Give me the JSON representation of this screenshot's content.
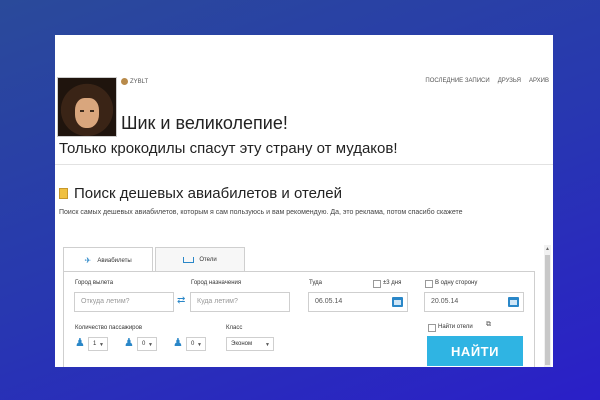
{
  "header": {
    "username": "ZYBLT",
    "nav": [
      "ПОСЛЕДНИЕ ЗАПИСИ",
      "ДРУЗЬЯ",
      "АРХИВ"
    ],
    "title": "Шик и великолепие!",
    "subtitle": "Только крокодилы спасут эту страну от мудаков!"
  },
  "section": {
    "title": "Поиск дешевых авиабилетов и отелей",
    "desc": "Поиск самых дешевых авиабилетов, которым я сам пользуюсь и вам рекомендую. Да, это реклама, потом спасибо скажете"
  },
  "widget": {
    "tabs": [
      "Авиабилеты",
      "Отели"
    ],
    "from_label": "Город вылета",
    "from_placeholder": "Откуда летим?",
    "to_label": "Город назначения",
    "to_placeholder": "Куда летим?",
    "depart_label": "Туда",
    "depart_value": "06.05.14",
    "flex_label": "±3 дня",
    "oneway_label": "В одну сторону",
    "return_value": "20.05.14",
    "passengers_label": "Количество пассажиров",
    "adults": "1",
    "children": "0",
    "infants": "0",
    "class_label": "Класс",
    "class_value": "Эконом",
    "hotels_label": "Найти отели",
    "search_button": "НАЙТИ"
  },
  "colors": {
    "accent": "#2a87c8",
    "button": "#2fb4e3"
  }
}
